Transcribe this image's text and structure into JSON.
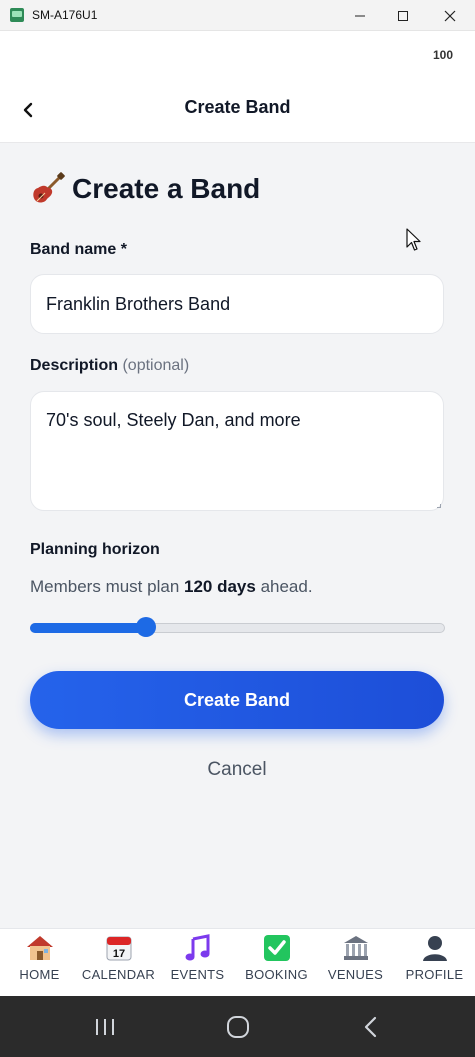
{
  "window": {
    "title": "SM-A176U1"
  },
  "status": {
    "battery": "100"
  },
  "header": {
    "title": "Create Band"
  },
  "page": {
    "title": "Create a Band",
    "title_icon": "guitar-icon"
  },
  "form": {
    "name_label": "Band name *",
    "name_value": "Franklin Brothers Band",
    "desc_label": "Description",
    "desc_optional": "(optional)",
    "desc_value": "70's soul, Steely Dan, and more",
    "horizon_label": "Planning horizon",
    "horizon_prefix": "Members must plan ",
    "horizon_value": "120 days",
    "horizon_suffix": " ahead.",
    "slider_fraction": 0.28
  },
  "actions": {
    "submit": "Create Band",
    "cancel": "Cancel"
  },
  "nav": [
    {
      "label": "HOME",
      "icon": "house-icon"
    },
    {
      "label": "CALENDAR",
      "icon": "calendar-icon"
    },
    {
      "label": "EVENTS",
      "icon": "music-note-icon"
    },
    {
      "label": "BOOKING",
      "icon": "check-mark-icon"
    },
    {
      "label": "VENUES",
      "icon": "venue-building-icon"
    },
    {
      "label": "PROFILE",
      "icon": "person-icon"
    }
  ],
  "colors": {
    "primary": "#2563eb",
    "accent_slider": "#1d6ae5",
    "background": "#f3f4f6"
  }
}
